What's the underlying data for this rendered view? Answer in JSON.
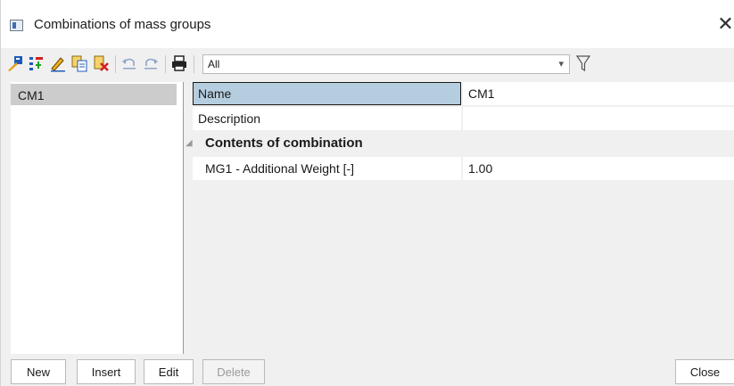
{
  "window": {
    "title": "Combinations of mass groups",
    "close_glyph": "✕"
  },
  "toolbar": {
    "icons": [
      "new-icon",
      "insert-icon",
      "edit-icon",
      "copy-icon",
      "delete-icon",
      "undo-icon",
      "redo-icon",
      "print-icon",
      "filter-icon"
    ],
    "filter_value": "All",
    "filter_arrow": "▾"
  },
  "list": {
    "items": [
      {
        "label": "CM1",
        "selected": true
      }
    ]
  },
  "properties": {
    "rows": [
      {
        "name": "Name",
        "value": "CM1"
      },
      {
        "name": "Description",
        "value": ""
      }
    ],
    "group": {
      "label": "Contents of combination",
      "collapse_glyph": "◢",
      "rows": [
        {
          "name": "MG1 - Additional Weight [-]",
          "value": "1.00"
        }
      ]
    }
  },
  "buttons": {
    "new": "New",
    "insert": "Insert",
    "edit": "Edit",
    "delete": "Delete",
    "close": "Close"
  },
  "colors": {
    "selection_list": "#cccccc",
    "selection_grid": "#b5cedf",
    "window_bg": "#f0f0f0"
  }
}
